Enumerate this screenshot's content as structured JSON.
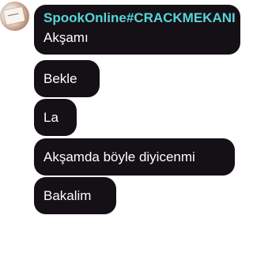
{
  "chat": {
    "sender": "SpookOnline#CRACKMEKANI",
    "messages": [
      "Akşamı",
      "Bekle",
      "La",
      "Akşamda böyle diyicenmi",
      "Bakalim"
    ]
  },
  "colors": {
    "bubble_background": "#141016",
    "username": "#56d6d8",
    "message_text": "#ffffff",
    "page_background": "#ffffff"
  }
}
